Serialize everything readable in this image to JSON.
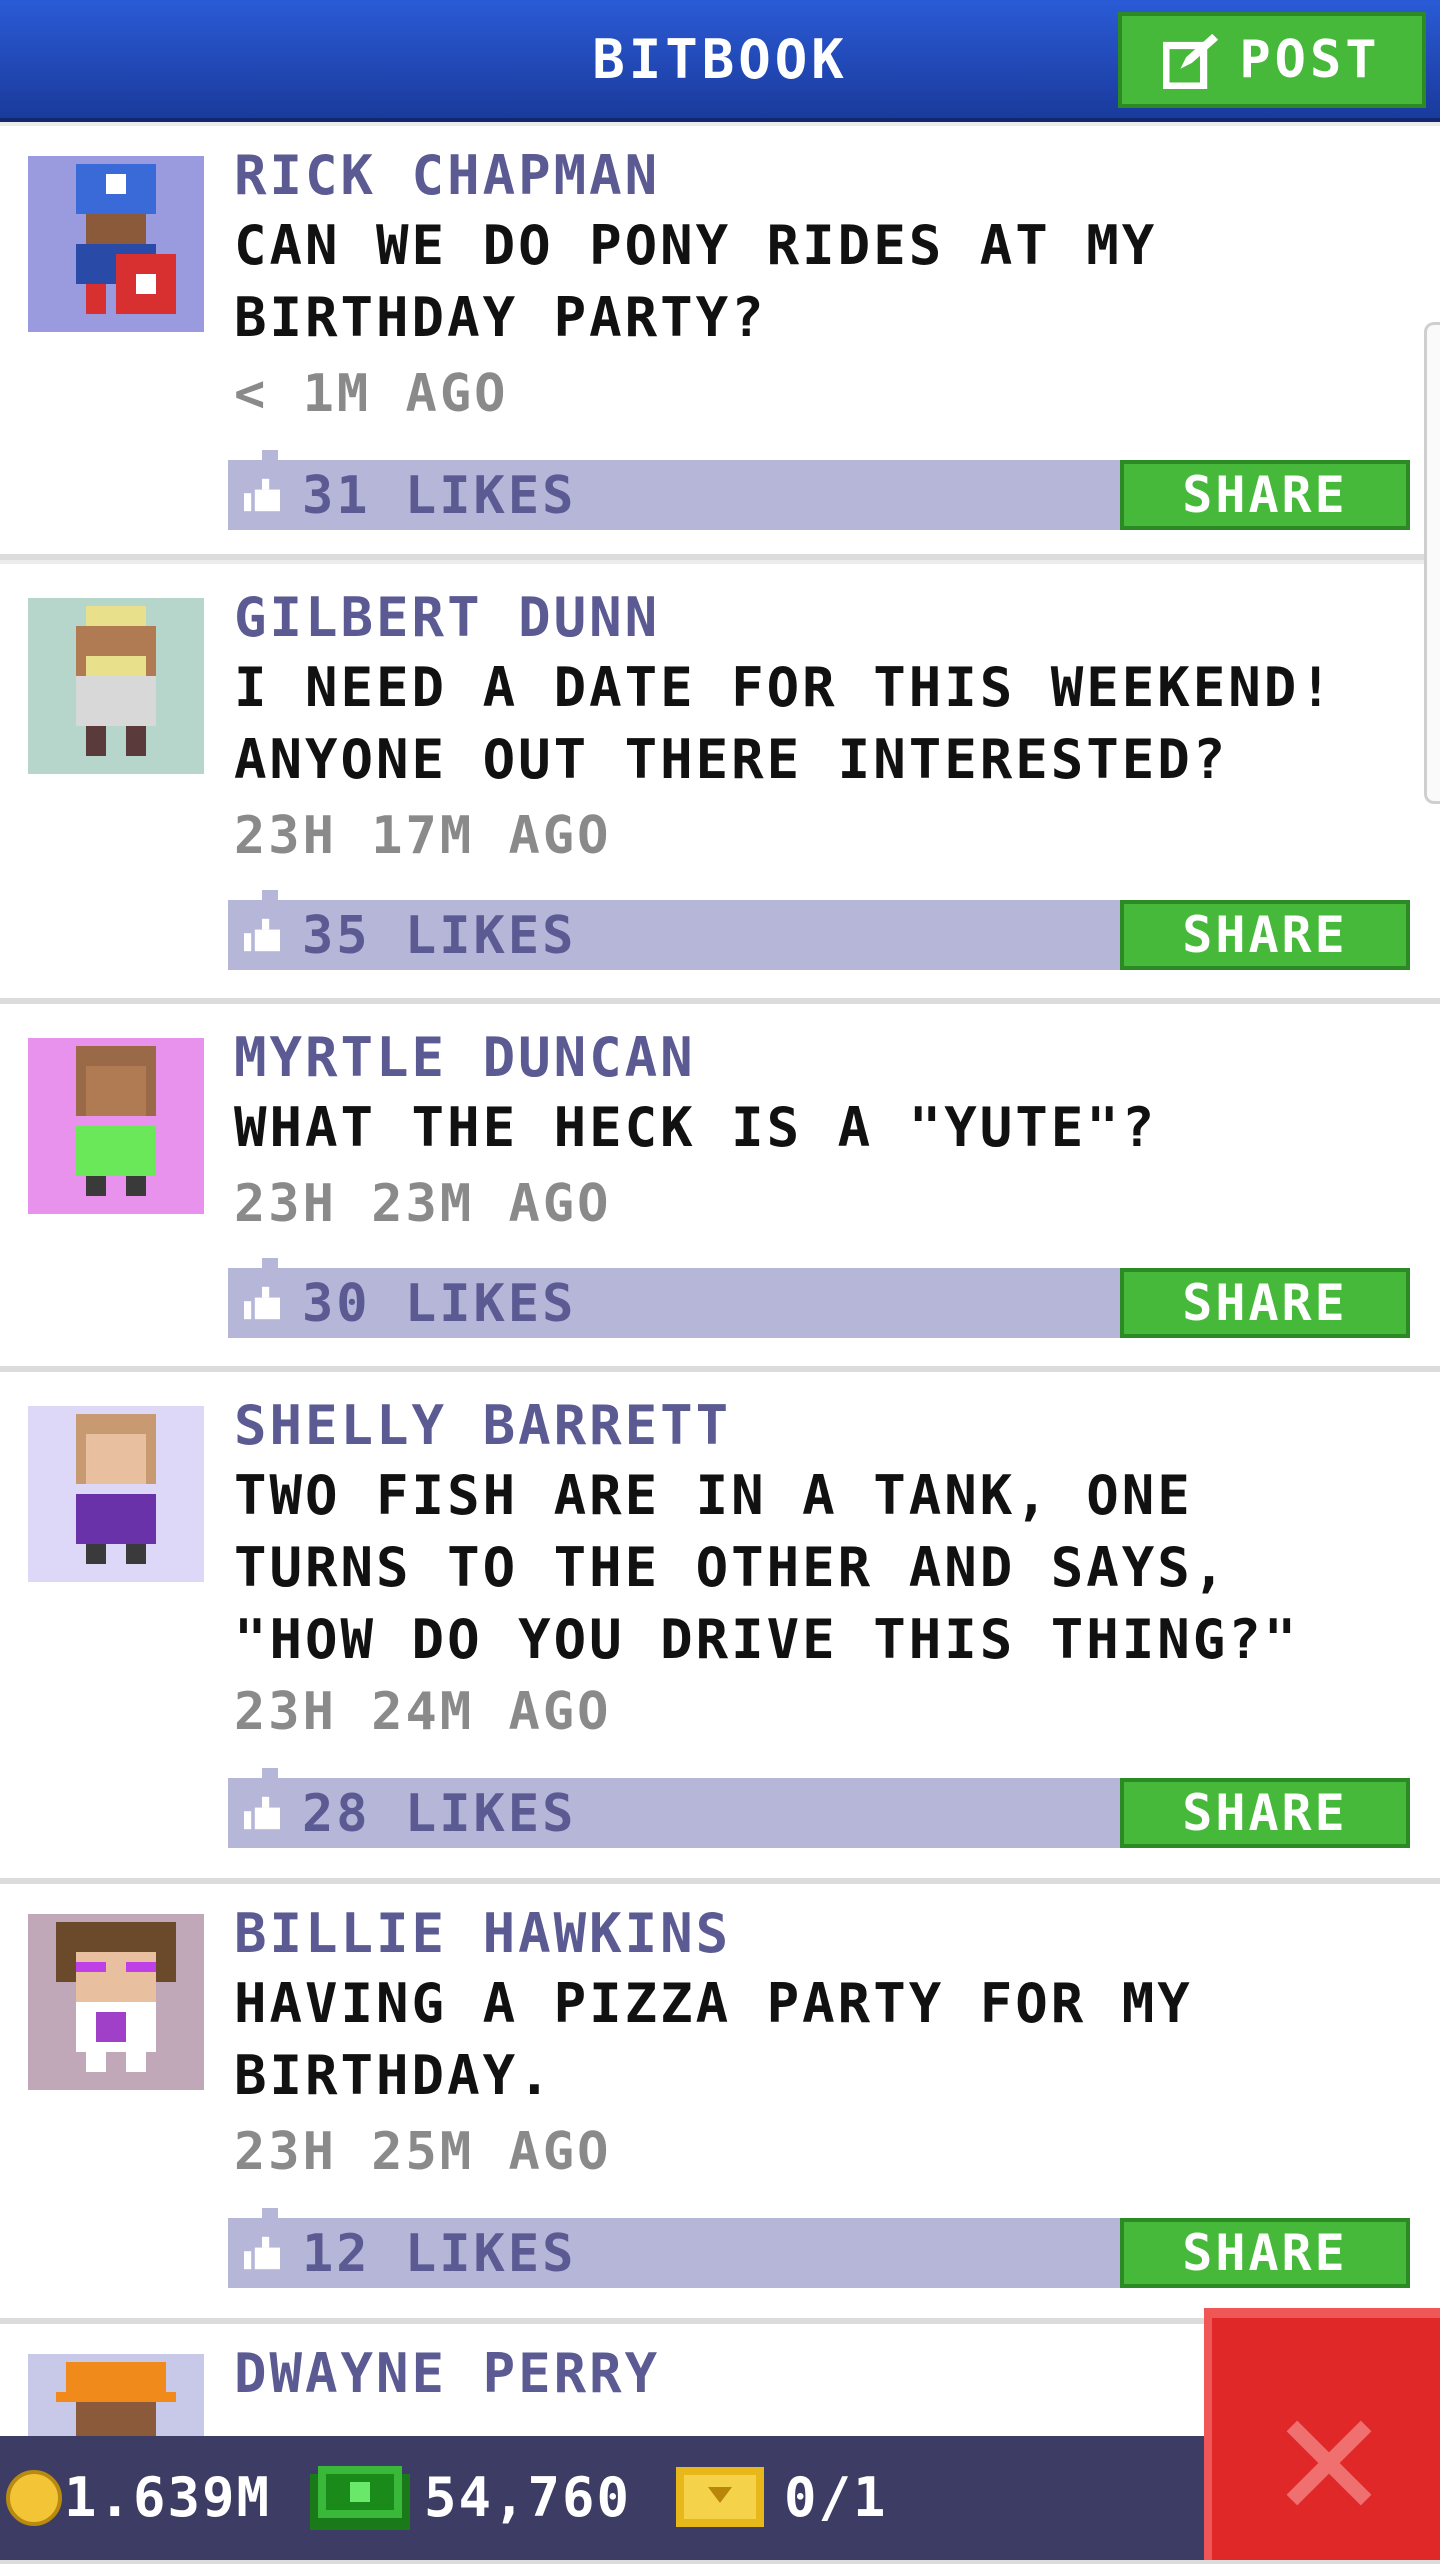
{
  "header": {
    "title": "BITBOOK",
    "post_label": "POST",
    "post_icon": "compose-icon"
  },
  "posts": [
    {
      "name": "RICK CHAPMAN",
      "text": "CAN WE DO PONY RIDES AT MY BIRTHDAY PARTY?",
      "time": "< 1M AGO",
      "likes": "31 LIKES",
      "share": "SHARE",
      "avatar_bg": "#9a9ade"
    },
    {
      "name": "GILBERT DUNN",
      "text": "I NEED A DATE FOR THIS WEEKEND! ANYONE OUT THERE INTERESTED?",
      "time": "23H 17M AGO",
      "likes": "35 LIKES",
      "share": "SHARE",
      "avatar_bg": "#b6d6cc"
    },
    {
      "name": "MYRTLE DUNCAN",
      "text": "WHAT THE HECK IS A \"YUTE\"?",
      "time": "23H 23M AGO",
      "likes": "30 LIKES",
      "share": "SHARE",
      "avatar_bg": "#e892ee"
    },
    {
      "name": "SHELLY BARRETT",
      "text": "TWO FISH ARE IN A TANK, ONE TURNS TO THE OTHER AND SAYS, \"HOW DO YOU DRIVE THIS THING?\"",
      "time": "23H 24M AGO",
      "likes": "28 LIKES",
      "share": "SHARE",
      "avatar_bg": "#ddd8f8"
    },
    {
      "name": "BILLIE HAWKINS",
      "text": "HAVING A PIZZA PARTY FOR MY BIRTHDAY.",
      "time": "23H 25M AGO",
      "likes": "12 LIKES",
      "share": "SHARE",
      "avatar_bg": "#c0a8b8"
    },
    {
      "name": "DWAYNE PERRY",
      "text": "",
      "time": "",
      "likes": "",
      "share": "",
      "avatar_bg": "#c8c8e8"
    }
  ],
  "footer": {
    "coins": "1.639M",
    "bux": "54,760",
    "tickets": "0/1",
    "coin_icon": "coin-icon",
    "bux_icon": "bitbux-icon",
    "ticket_icon": "ticket-icon",
    "close_icon": "close-icon"
  },
  "colors": {
    "header": "#1a3a9c",
    "accent_green": "#46b83a",
    "name_purple": "#5b5a92",
    "like_bar": "#b6b6d8",
    "close_red": "#e02828"
  }
}
